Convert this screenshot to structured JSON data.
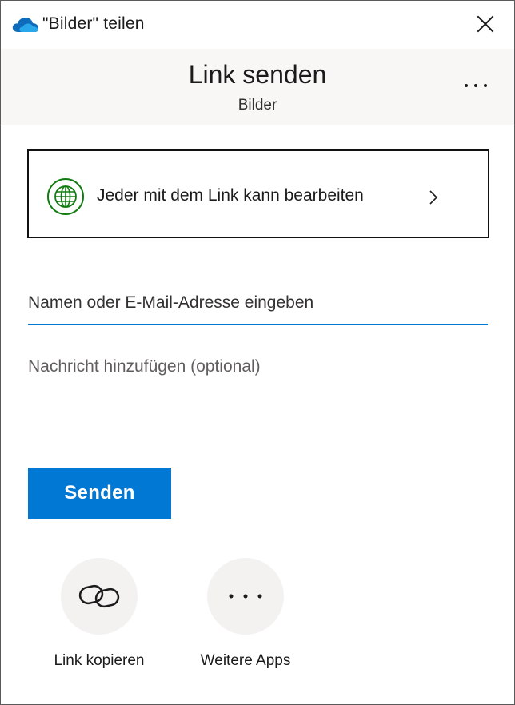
{
  "window": {
    "title": "\"Bilder\" teilen",
    "icon": "onedrive-cloud-icon",
    "close_icon": "close-icon"
  },
  "header": {
    "title": "Link senden",
    "subtitle": "Bilder",
    "more_icon": "more-options-icon"
  },
  "permission": {
    "label": "Jeder mit dem Link kann bearbeiten",
    "icon": "globe-icon",
    "chevron": "chevron-right-icon"
  },
  "to_field": {
    "value": "",
    "placeholder": "Namen oder E-Mail-Adresse eingeben"
  },
  "message_field": {
    "value": "",
    "placeholder": "Nachricht hinzufügen (optional)"
  },
  "send_button": {
    "label": "Senden"
  },
  "actions": [
    {
      "label": "Link kopieren",
      "icon": "link-icon"
    },
    {
      "label": "Weitere Apps",
      "icon": "more-horizontal-icon"
    }
  ],
  "colors": {
    "accent": "#0078d4",
    "globe": "#107c10",
    "header_bg": "#f8f7f6",
    "action_circle": "#f3f2f1"
  }
}
